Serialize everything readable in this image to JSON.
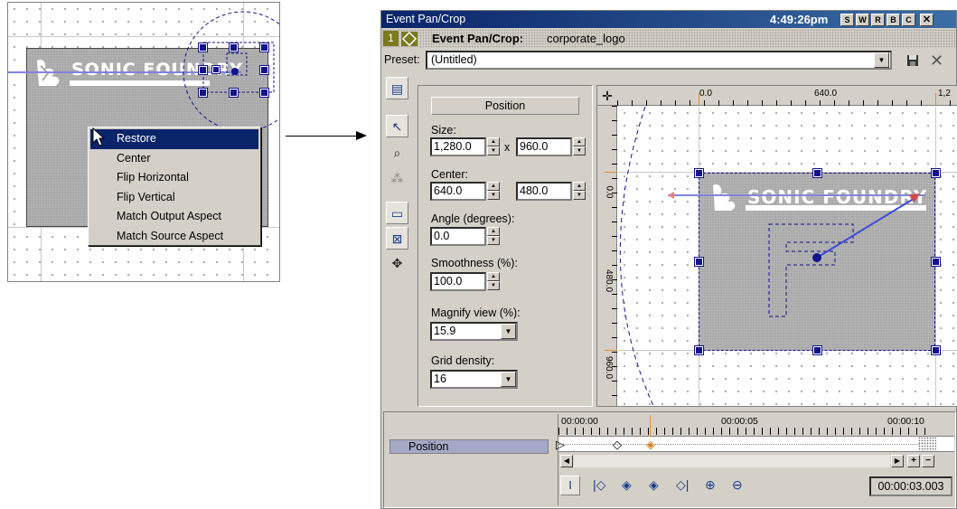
{
  "context_menu": {
    "items": [
      "Restore",
      "Center",
      "Flip Horizontal",
      "Flip Vertical",
      "Match Output Aspect",
      "Match Source Aspect"
    ],
    "selected": "Restore"
  },
  "logo_text": "SONIC FOUNDRY",
  "window": {
    "title": "Event Pan/Crop",
    "clock": "4:49:26pm",
    "title_buttons": [
      "S",
      "W",
      "R",
      "B",
      "C"
    ],
    "track_number": "1",
    "header_label": "Event Pan/Crop:",
    "header_value": "corporate_logo",
    "preset_label": "Preset:",
    "preset_value": "(Untitled)"
  },
  "properties": {
    "section_title": "Position",
    "size_label": "Size:",
    "size_w": "1,280.0",
    "size_x_sep": "x",
    "size_h": "960.0",
    "center_label": "Center:",
    "center_x": "640.0",
    "center_y": "480.0",
    "angle_label": "Angle (degrees):",
    "angle_value": "0.0",
    "smooth_label": "Smoothness (%):",
    "smooth_value": "100.0",
    "magnify_label": "Magnify view (%):",
    "magnify_value": "15.9",
    "grid_label": "Grid density:",
    "grid_value": "16"
  },
  "ruler": {
    "top": [
      "0.0",
      "640.0",
      "1,2"
    ],
    "left": [
      "0.0",
      "480.0",
      "960.0"
    ]
  },
  "timeline": {
    "track_label": "Position",
    "times": [
      "00:00:00",
      "00:00:05",
      "00:00:10"
    ],
    "timecode": "00:00:03.003"
  }
}
